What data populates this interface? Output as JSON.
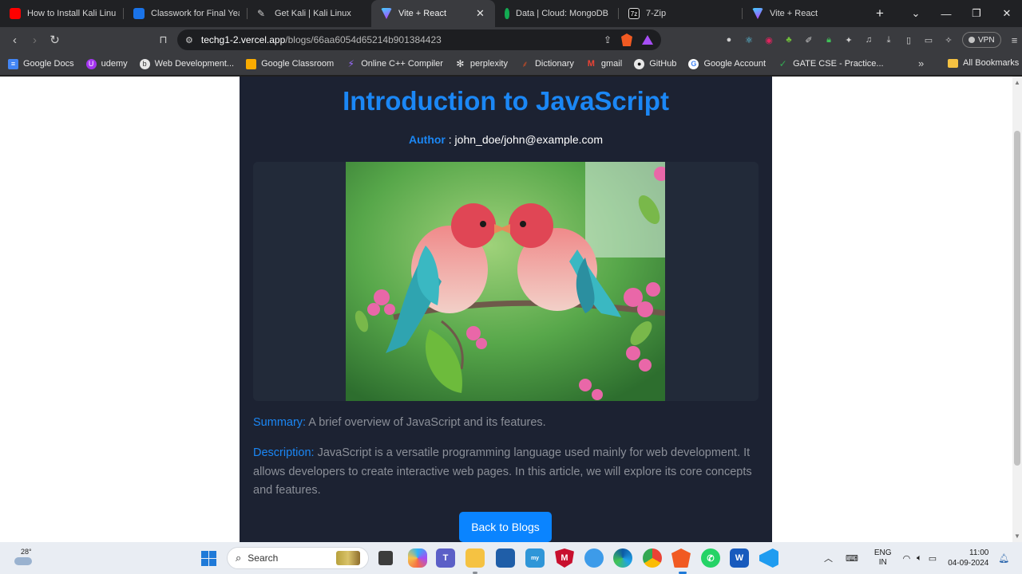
{
  "browser": {
    "tabs": [
      {
        "title": "How to Install Kali Linux in",
        "favicon": "youtube-icon",
        "color": "#ff0000",
        "active": false
      },
      {
        "title": "Classwork for Final Year C",
        "favicon": "classroom-icon",
        "color": "#1a73e8",
        "active": false
      },
      {
        "title": "Get Kali | Kali Linux",
        "favicon": "kali-icon",
        "color": "#cfcfcf",
        "active": false
      },
      {
        "title": "Vite + React",
        "favicon": "vite-icon",
        "color": "#a95cff",
        "active": true
      },
      {
        "title": "Data | Cloud: MongoDB C",
        "favicon": "mongodb-icon",
        "color": "#13aa52",
        "active": false
      },
      {
        "title": "7-Zip",
        "favicon": "7zip-icon",
        "color": "#ffffff",
        "active": false
      },
      {
        "title": "Vite + React",
        "favicon": "vite-icon",
        "color": "#a95cff",
        "active": false
      }
    ],
    "url_host": "techg1-2.vercel.app",
    "url_path": "/blogs/66aa6054d65214b901384423",
    "vpn_label": "VPN",
    "bookmarks": [
      {
        "label": "Google Docs",
        "icon": "docs-icon",
        "color": "#4285f4"
      },
      {
        "label": "udemy",
        "icon": "udemy-icon",
        "color": "#a435f0"
      },
      {
        "label": "Web Development...",
        "icon": "web-dev-icon",
        "color": "#333333"
      },
      {
        "label": "Google Classroom",
        "icon": "classroom-icon",
        "color": "#f9ab00"
      },
      {
        "label": "Online C++ Compiler",
        "icon": "compiler-icon",
        "color": "#7b3fe4"
      },
      {
        "label": "perplexity",
        "icon": "perplexity-icon",
        "color": "#444444"
      },
      {
        "label": "Dictionary",
        "icon": "dictionary-icon",
        "color": "#c04b28"
      },
      {
        "label": "gmail",
        "icon": "gmail-icon",
        "color": "#ea4335"
      },
      {
        "label": "GitHub",
        "icon": "github-icon",
        "color": "#111111"
      },
      {
        "label": "Google Account",
        "icon": "google-icon",
        "color": "#4285f4"
      },
      {
        "label": "GATE CSE - Practice...",
        "icon": "gate-icon",
        "color": "#1e8e3e"
      }
    ],
    "all_bookmarks_label": "All Bookmarks"
  },
  "post": {
    "title": "Introduction to JavaScript",
    "author_label": "Author",
    "author_value": " : john_doe/john@example.com",
    "summary_label": "Summary:",
    "summary_text": " A brief overview of JavaScript and its features.",
    "description_label": "Description:",
    "description_text": " JavaScript is a versatile programming language used mainly for web development. It allows developers to create interactive web pages. In this article, we will explore its core concepts and features.",
    "back_button": "Back to Blogs",
    "accent_color": "#1b87f5"
  },
  "taskbar": {
    "temperature": "28°",
    "search_placeholder": "Search",
    "lang_line1": "ENG",
    "lang_line2": "IN",
    "time": "11:00",
    "date": "04-09-2024"
  }
}
